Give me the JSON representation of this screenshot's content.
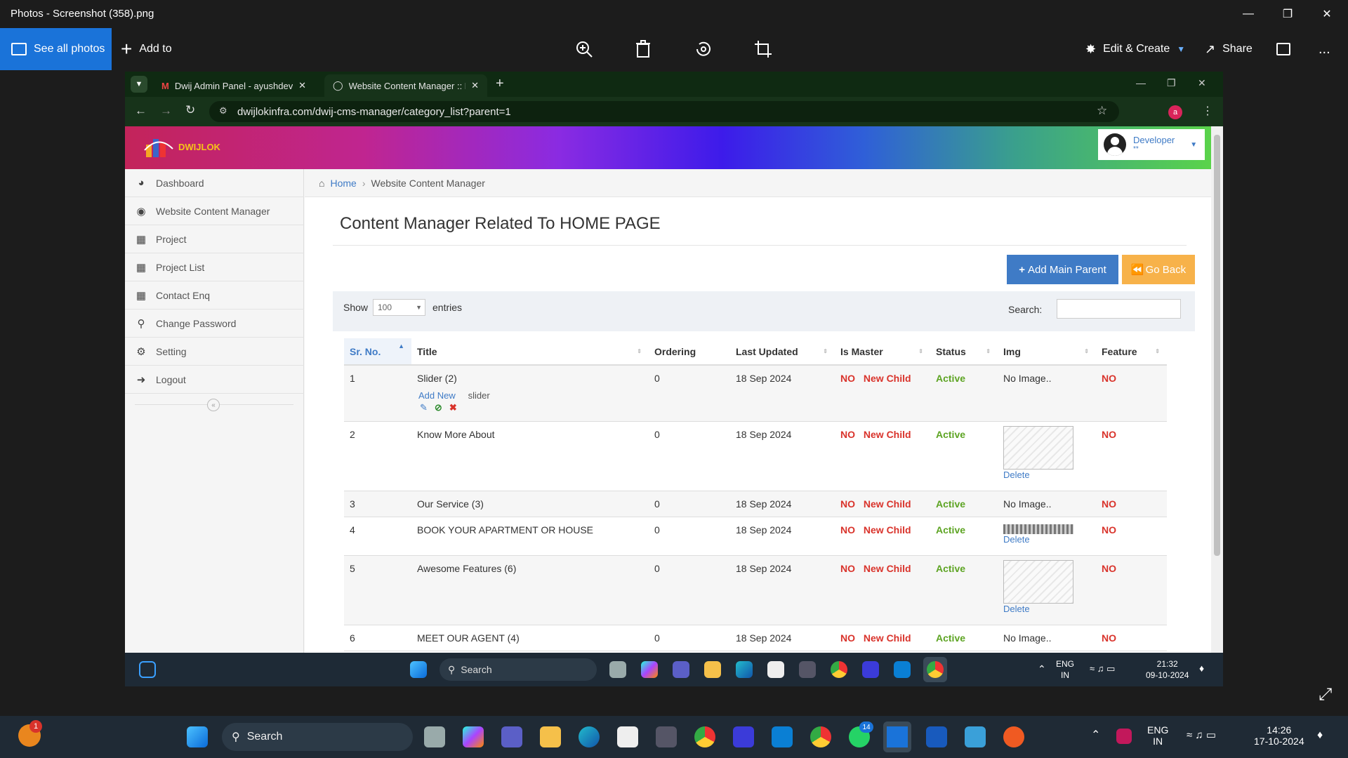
{
  "photos": {
    "title": "Photos - Screenshot (358).png",
    "see_all": "See all photos",
    "add_to": "Add to",
    "edit_create": "Edit & Create",
    "share": "Share",
    "more": "..."
  },
  "browser": {
    "tabs": [
      {
        "label": "Dwij Admin Panel - ayushdevin"
      },
      {
        "label": "Website Content Manager :: Dv"
      }
    ],
    "url": "dwijlokinfra.com/dwij-cms-manager/category_list?parent=1",
    "profile_initial": "a"
  },
  "site": {
    "logo_text": "DWIJLOK",
    "user_name": "Developer",
    "user_sub": "**",
    "sidebar": [
      {
        "label": "Dashboard",
        "icon": "dashboard-icon"
      },
      {
        "label": "Website Content Manager",
        "icon": "globe-icon"
      },
      {
        "label": "Project",
        "icon": "table-icon"
      },
      {
        "label": "Project List",
        "icon": "table-icon"
      },
      {
        "label": "Contact Enq",
        "icon": "table-icon"
      },
      {
        "label": "Change Password",
        "icon": "key-icon"
      },
      {
        "label": "Setting",
        "icon": "gear-icon"
      },
      {
        "label": "Logout",
        "icon": "logout-icon"
      }
    ],
    "breadcrumb": {
      "home": "Home",
      "current": "Website Content Manager"
    },
    "page_title": "Content Manager Related To HOME PAGE",
    "add_main_parent": "Add Main Parent",
    "go_back": "Go Back",
    "show_label": "Show",
    "entries_value": "100",
    "entries_label": "entries",
    "search_label": "Search:",
    "columns": [
      "Sr. No.",
      "Title",
      "Ordering",
      "Last Updated",
      "Is Master",
      "Status",
      "Img",
      "Feature"
    ],
    "rows": [
      {
        "sr": "1",
        "title": "Slider (2)",
        "sub_add": "Add New",
        "sub_text": "slider",
        "ordering": "0",
        "updated": "18 Sep 2024",
        "master": "NO",
        "child": "New Child",
        "status": "Active",
        "img": "No Image..",
        "img_action": "",
        "feature": "NO"
      },
      {
        "sr": "2",
        "title": "Know More About",
        "ordering": "0",
        "updated": "18 Sep 2024",
        "master": "NO",
        "child": "New Child",
        "status": "Active",
        "img": "",
        "img_action": "Delete",
        "feature": "NO"
      },
      {
        "sr": "3",
        "title": "Our Service (3)",
        "ordering": "0",
        "updated": "18 Sep 2024",
        "master": "NO",
        "child": "New Child",
        "status": "Active",
        "img": "No Image..",
        "img_action": "",
        "feature": "NO"
      },
      {
        "sr": "4",
        "title": "BOOK YOUR APARTMENT OR HOUSE",
        "ordering": "0",
        "updated": "18 Sep 2024",
        "master": "NO",
        "child": "New Child",
        "status": "Active",
        "img": "",
        "img_action": "Delete",
        "feature": "NO"
      },
      {
        "sr": "5",
        "title": "Awesome Features (6)",
        "ordering": "0",
        "updated": "18 Sep 2024",
        "master": "NO",
        "child": "New Child",
        "status": "Active",
        "img": "",
        "img_action": "Delete",
        "feature": "NO"
      },
      {
        "sr": "6",
        "title": "MEET OUR AGENT (4)",
        "ordering": "0",
        "updated": "18 Sep 2024",
        "master": "NO",
        "child": "New Child",
        "status": "Active",
        "img": "No Image..",
        "img_action": "",
        "feature": "NO"
      }
    ]
  },
  "inner_taskbar": {
    "search": "Search",
    "lang": "ENG",
    "region": "IN",
    "time": "21:32",
    "date": "09-10-2024"
  },
  "outer_taskbar": {
    "search": "Search",
    "lang": "ENG",
    "region": "IN",
    "time": "14:26",
    "date": "17-10-2024",
    "notif_badge": "1",
    "whatsapp_badge": "14"
  },
  "colors": {
    "primary": "#3f7bc6",
    "warning": "#f7b24a",
    "red": "#d9332b",
    "green": "#5da423"
  }
}
